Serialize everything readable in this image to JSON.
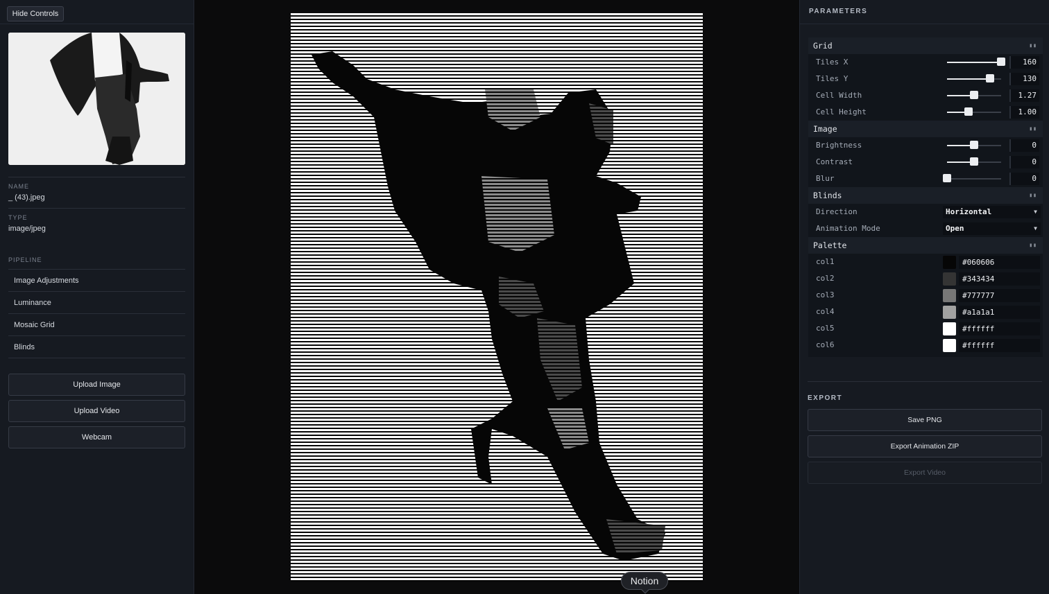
{
  "left": {
    "hide_controls": "Hide Controls",
    "name_label": "NAME",
    "name_value": "_ (43).jpeg",
    "type_label": "TYPE",
    "type_value": "image/jpeg",
    "pipeline_label": "PIPELINE",
    "pipeline": [
      "Image Adjustments",
      "Luminance",
      "Mosaic Grid",
      "Blinds"
    ],
    "upload_image": "Upload Image",
    "upload_video": "Upload Video",
    "webcam": "Webcam"
  },
  "parameters": {
    "title": "PARAMETERS",
    "grid": {
      "title": "Grid",
      "tiles_x": {
        "label": "Tiles X",
        "value": "160",
        "level": 1.0
      },
      "tiles_y": {
        "label": "Tiles Y",
        "value": "130",
        "level": 0.8
      },
      "cell_width": {
        "label": "Cell Width",
        "value": "1.27",
        "level": 0.5
      },
      "cell_height": {
        "label": "Cell Height",
        "value": "1.00",
        "level": 0.4
      }
    },
    "image": {
      "title": "Image",
      "brightness": {
        "label": "Brightness",
        "value": "0",
        "level": 0.5
      },
      "contrast": {
        "label": "Contrast",
        "value": "0",
        "level": 0.5
      },
      "blur": {
        "label": "Blur",
        "value": "0",
        "level": 0.0
      }
    },
    "blinds": {
      "title": "Blinds",
      "direction": {
        "label": "Direction",
        "value": "Horizontal"
      },
      "animation_mode": {
        "label": "Animation Mode",
        "value": "Open"
      }
    },
    "palette": {
      "title": "Palette",
      "colors": [
        {
          "label": "col1",
          "value": "#060606"
        },
        {
          "label": "col2",
          "value": "#343434"
        },
        {
          "label": "col3",
          "value": "#777777"
        },
        {
          "label": "col4",
          "value": "#a1a1a1"
        },
        {
          "label": "col5",
          "value": "#ffffff"
        },
        {
          "label": "col6",
          "value": "#ffffff"
        }
      ]
    }
  },
  "export": {
    "title": "EXPORT",
    "save_png": "Save PNG",
    "export_zip": "Export Animation ZIP",
    "export_video": "Export Video"
  },
  "tooltip": "Notion",
  "icons": {
    "folder_grip": "grip-icon",
    "dropdown": "chevron-down-icon"
  },
  "colors": {
    "panel_bg": "#161a21",
    "canvas_bg": "#0b0b0c",
    "accent": "#eceef1"
  }
}
